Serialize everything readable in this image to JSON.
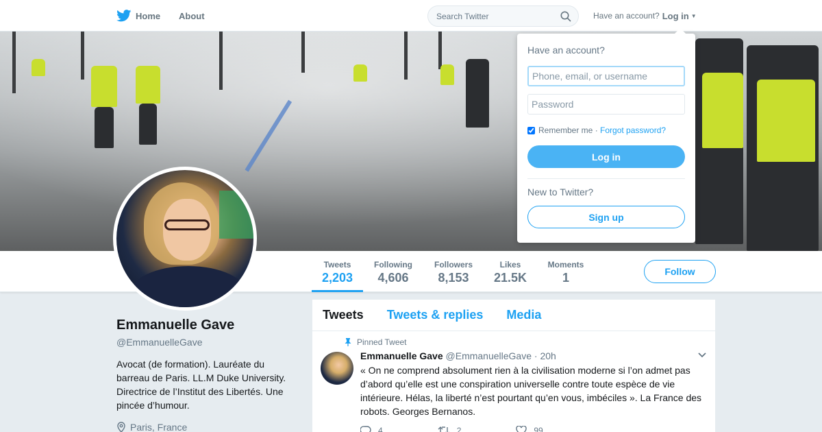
{
  "nav": {
    "home": "Home",
    "about": "About",
    "search_placeholder": "Search Twitter",
    "account_prompt": "Have an account?",
    "login": "Log in"
  },
  "profile": {
    "name": "Emmanuelle Gave",
    "handle": "@EmmanuelleGave",
    "bio": "Avocat (de formation). Lauréate du barreau de Paris. LL.M Duke University. Directrice de l’Institut des Libertés. Une pincée d’humour.",
    "location": "Paris, France"
  },
  "stats": [
    {
      "label": "Tweets",
      "value": "2,203"
    },
    {
      "label": "Following",
      "value": "4,606"
    },
    {
      "label": "Followers",
      "value": "8,153"
    },
    {
      "label": "Likes",
      "value": "21.5K"
    },
    {
      "label": "Moments",
      "value": "1"
    }
  ],
  "follow_label": "Follow",
  "tabs": [
    "Tweets",
    "Tweets & replies",
    "Media"
  ],
  "tweet": {
    "pinned_label": "Pinned Tweet",
    "author": "Emmanuelle Gave",
    "handle": "@EmmanuelleGave",
    "time": "· 20h",
    "text": "« On ne comprend absolument rien à la civilisation moderne si l’on admet pas d’abord qu’elle est une conspiration universelle contre toute espèce de vie intérieure. Hélas, la liberté n’est pourtant qu’en vous, imbéciles ». La France des robots. Georges Bernanos.",
    "replies": "4",
    "retweets": "2",
    "likes": "99"
  },
  "dropdown": {
    "title": "Have an account?",
    "username_placeholder": "Phone, email, or username",
    "password_placeholder": "Password",
    "remember": "Remember me",
    "separator": " · ",
    "forgot": "Forgot password?",
    "login_button": "Log in",
    "new_prompt": "New to Twitter?",
    "signup_button": "Sign up"
  },
  "colors": {
    "accent": "#1da1f2",
    "login_button": "#4ab3f4"
  }
}
